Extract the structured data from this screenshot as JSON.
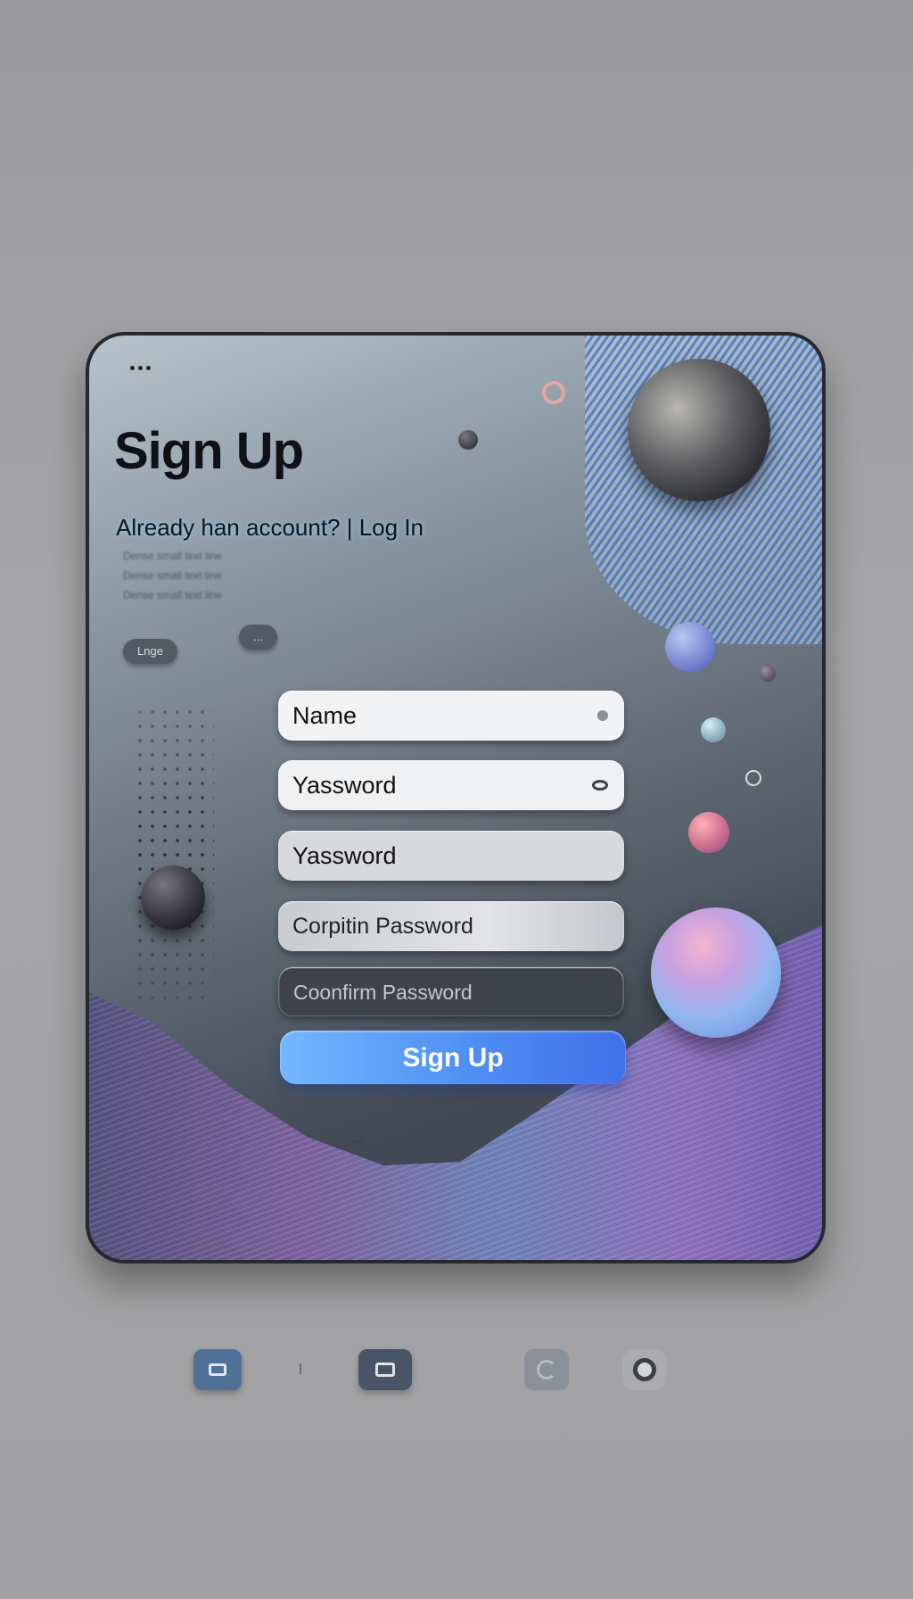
{
  "card": {
    "title": "Sign Up",
    "subtitle_prefix": "Already han account? |",
    "login_link": "Log In",
    "blurred_lines": [
      "Dense small text line",
      "Dense small text line",
      "Dense small text line"
    ],
    "chips": [
      "Lnge",
      "..."
    ]
  },
  "form": {
    "name_field": "Name",
    "password_field_1": "Yassword",
    "password_field_2": "Yassword",
    "confirm_field_1": "Corpitin  Password",
    "confirm_field_2": "Coonfirm Password",
    "submit_label": "Sign Up"
  },
  "footer": {
    "note": "..."
  },
  "colors": {
    "accent": "#4f8ff4",
    "background": "#a2a2a4"
  },
  "bottom_icons": [
    "photo-icon",
    "window-icon",
    "refresh-icon",
    "target-icon"
  ]
}
